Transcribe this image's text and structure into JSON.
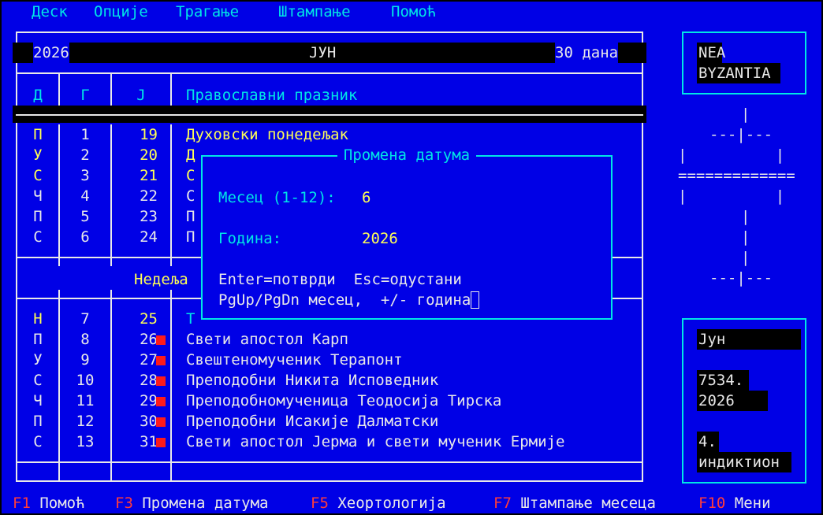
{
  "menu": {
    "items": [
      {
        "label": "Деск"
      },
      {
        "label": "Опције"
      },
      {
        "label": "Трагање"
      },
      {
        "label": "Штампање"
      },
      {
        "label": "Помоћ"
      }
    ]
  },
  "calendar": {
    "year": "2026",
    "month": "ЈУН",
    "days_label": "30 дана",
    "columns": {
      "day": "Д",
      "civil": "Г",
      "julian": "Ј",
      "holiday": "Православни празник"
    },
    "rows_top": [
      {
        "day": "П",
        "civil": "1",
        "julian": "19",
        "feast": "Духовски понедељак"
      },
      {
        "day": "У",
        "civil": "2",
        "julian": "20",
        "feast": "Д"
      },
      {
        "day": "С",
        "civil": "3",
        "julian": "21",
        "feast": "С"
      },
      {
        "day": "Ч",
        "civil": "4",
        "julian": "22",
        "feast": "С"
      },
      {
        "day": "П",
        "civil": "5",
        "julian": "23",
        "feast": "П"
      },
      {
        "day": "С",
        "civil": "6",
        "julian": "24",
        "feast": "П"
      }
    ],
    "week_label": "Недеља",
    "rows_bottom": [
      {
        "day": "Н",
        "civil": "7",
        "julian": "25",
        "feast": "Т"
      },
      {
        "day": "П",
        "civil": "8",
        "julian": "26",
        "feast": "Свети апостол Карп"
      },
      {
        "day": "У",
        "civil": "9",
        "julian": "27",
        "feast": "Свештеномученик Терапонт"
      },
      {
        "day": "С",
        "civil": "10",
        "julian": "28",
        "feast": "Преподобни Никита Исповедник"
      },
      {
        "day": "Ч",
        "civil": "11",
        "julian": "29",
        "feast": "Преподобномученица Теодосија Тирска"
      },
      {
        "day": "П",
        "civil": "12",
        "julian": "30",
        "feast": "Преподобни Исакије Далматски"
      },
      {
        "day": "С",
        "civil": "13",
        "julian": "31",
        "feast": "Свети апостол Јерма и свети мученик Ермије"
      }
    ]
  },
  "sidebar": {
    "logo_line1": "NEA",
    "logo_line2": "BYZANTIA",
    "cross": {
      "l1": "|",
      "l2": "---|---",
      "l3": "|   |   |",
      "l4": "=============",
      "l5": "|   |   |",
      "l6": "|",
      "l7": "|",
      "l8": "|",
      "l9": "---|---"
    },
    "month_name": "Јун",
    "byz_year": "7534.",
    "civil_year": "2026",
    "indiction_num": "4.",
    "indiction_label": "индиктион"
  },
  "dialog": {
    "title": "Промена датума",
    "month_label": "Месец (1-12):",
    "month_value": "6",
    "year_label": "Година:",
    "year_value": "2026",
    "help_line1": "Enter=потврди  Esc=одустани",
    "help_line2": "PgUp/PgDn месец,  +/- година"
  },
  "footer": {
    "keys": [
      {
        "key": "F1",
        "label": " Помоћ"
      },
      {
        "key": "F3",
        "label": " Промена датума"
      },
      {
        "key": "F5",
        "label": " Хеортологија"
      },
      {
        "key": "F7",
        "label": " Штампање месеца"
      },
      {
        "key": "F10",
        "label": " Мени"
      }
    ]
  },
  "colors": {
    "background": "#0000e6",
    "cyan": "#00e5e5",
    "yellow": "#ffff55",
    "white": "#e8e8e8",
    "red": "#ff3b3b"
  }
}
